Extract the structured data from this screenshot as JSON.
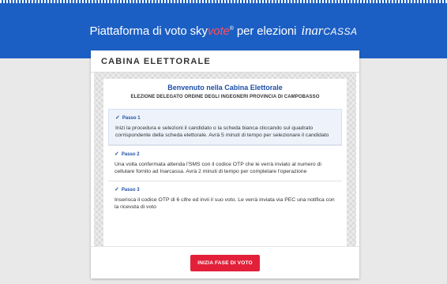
{
  "header": {
    "title_prefix": "Piattaforma di voto",
    "sky": "sky",
    "vote": "vote",
    "reg": "®",
    "title_suffix": "per elezioni",
    "brand_italic": "inar",
    "brand_caps": "CASSA"
  },
  "card": {
    "title": "CABINA ELETTORALE",
    "welcome_title": "Benvenuto nella Cabina Elettorale",
    "welcome_subtitle": "ELEZIONE DELEGATO ORDINE DEGLI INGEGNERI PROVINCIA DI CAMPOBASSO",
    "steps": [
      {
        "label": "Passo 1",
        "text": "Inizi la procedura e selezioni il candidato o la scheda bianca cliccando sul quadrato corrispondente della scheda elettorale. Avrà 5 minuti di tempo per selezionare il candidato"
      },
      {
        "label": "Passo 2",
        "text": "Una volta confermata attenda l'SMS con il codice OTP che le verrà inviato al numero di cellulare fornito ad Inarcassa. Avrà 2 minuti di tempo per completare l'operazione"
      },
      {
        "label": "Passo 3",
        "text": "Inserisca il codice OTP di 6 cifre ed invii il suo voto. Le verrà inviata via PEC una notifica con la ricevuta di voto"
      }
    ],
    "start_button": "INIZIA FASE DI VOTO"
  },
  "colors": {
    "header_blue": "#1c5fc4",
    "accent_red": "#e3203a",
    "step_blue": "#1c4fa8"
  }
}
